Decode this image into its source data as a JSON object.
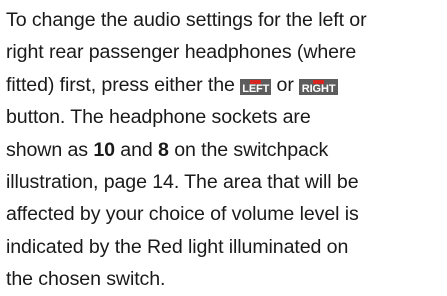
{
  "paragraph": {
    "l1": "To change the audio settings for the left or",
    "l2": "right rear passenger headphones (where",
    "l3_a": "fitted) first, press either the ",
    "l3_b": " or ",
    "l3_c": "",
    "l4": "button. The headphone sockets are",
    "l5_a": "shown as ",
    "l5_b": "10",
    "l5_c": " and ",
    "l5_d": "8",
    "l5_e": " on the switchpack",
    "l6": "illustration, page 14. The area that will be",
    "l7": "affected by your choice of volume level is",
    "l8": "indicated by the Red light illuminated on",
    "l9": "the chosen switch."
  },
  "buttons": {
    "left_label": "LEFT",
    "right_label": "RIGHT",
    "indicator_color": "#d6261f",
    "button_color": "#5d5d5d"
  }
}
